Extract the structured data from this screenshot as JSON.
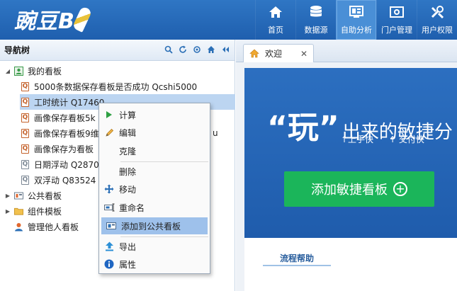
{
  "app": {
    "logo_text": "豌豆B"
  },
  "nav": [
    {
      "label": "首页",
      "icon": "home-icon"
    },
    {
      "label": "数据源",
      "icon": "database-icon"
    },
    {
      "label": "自助分析",
      "icon": "dashboard-icon",
      "active": true
    },
    {
      "label": "门户管理",
      "icon": "portal-icon"
    },
    {
      "label": "用户权限",
      "icon": "tools-icon"
    }
  ],
  "left_panel": {
    "title": "导航树",
    "tools": [
      "search-icon",
      "refresh-icon",
      "locate-icon",
      "home-icon",
      "collapse-icon"
    ]
  },
  "tree": {
    "root_my_boards": "我的看板",
    "items": [
      {
        "label": "5000条数据保存看板是否成功 Qcshi5000",
        "icon": "Q"
      },
      {
        "label": "工时统计 Q17460",
        "icon": "Q",
        "selected": true
      },
      {
        "label": "画像保存看板5k",
        "icon": "Q"
      },
      {
        "label": "画像保存看板9维",
        "icon": "Q",
        "trail": "u"
      },
      {
        "label": "画像保存为看板",
        "icon": "Q"
      },
      {
        "label": "日期浮动 Q2870",
        "icon": "Q"
      },
      {
        "label": "双浮动 Q83524",
        "icon": "Q"
      }
    ],
    "public_boards": "公共看板",
    "component_templates": "组件模板",
    "manage_others": "管理他人看板"
  },
  "context_menu": {
    "calc": "计算",
    "edit": "编辑",
    "clone": "克隆",
    "delete": "删除",
    "move": "移动",
    "rename": "重命名",
    "add_public": "添加到公共看板",
    "export": "导出",
    "props": "属性"
  },
  "tab": {
    "label": "欢迎"
  },
  "welcome": {
    "quote_open": "“",
    "play": "玩",
    "quote_close": "”",
    "headline_rest": "出来的敏捷分",
    "bullet_1": "↑上手快",
    "bullet_2": "↑ 交付快",
    "add_button": "添加敏捷看板",
    "help_tab": "流程帮助"
  },
  "colors": {
    "topbar": "#2567b8",
    "selection": "#bcd5f1",
    "green": "#1bb55a"
  }
}
